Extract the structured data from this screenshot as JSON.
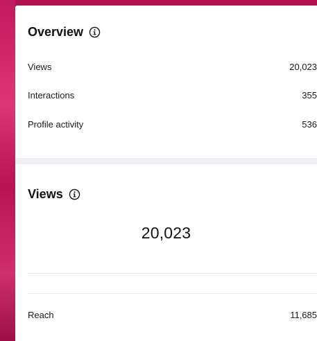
{
  "overview": {
    "title": "Overview",
    "rows": [
      {
        "label": "Views",
        "value": "20,023"
      },
      {
        "label": "Interactions",
        "value": "355"
      },
      {
        "label": "Profile activity",
        "value": "536"
      }
    ]
  },
  "views": {
    "title": "Views",
    "total": "20,023",
    "rows": [
      {
        "label": "Reach",
        "value": "11,685"
      }
    ]
  },
  "icons": {
    "info": "info-circle-icon"
  },
  "colors": {
    "background_accent": "#c4135a",
    "card": "#ffffff",
    "text": "#111111",
    "separator": "#eef0f3"
  }
}
